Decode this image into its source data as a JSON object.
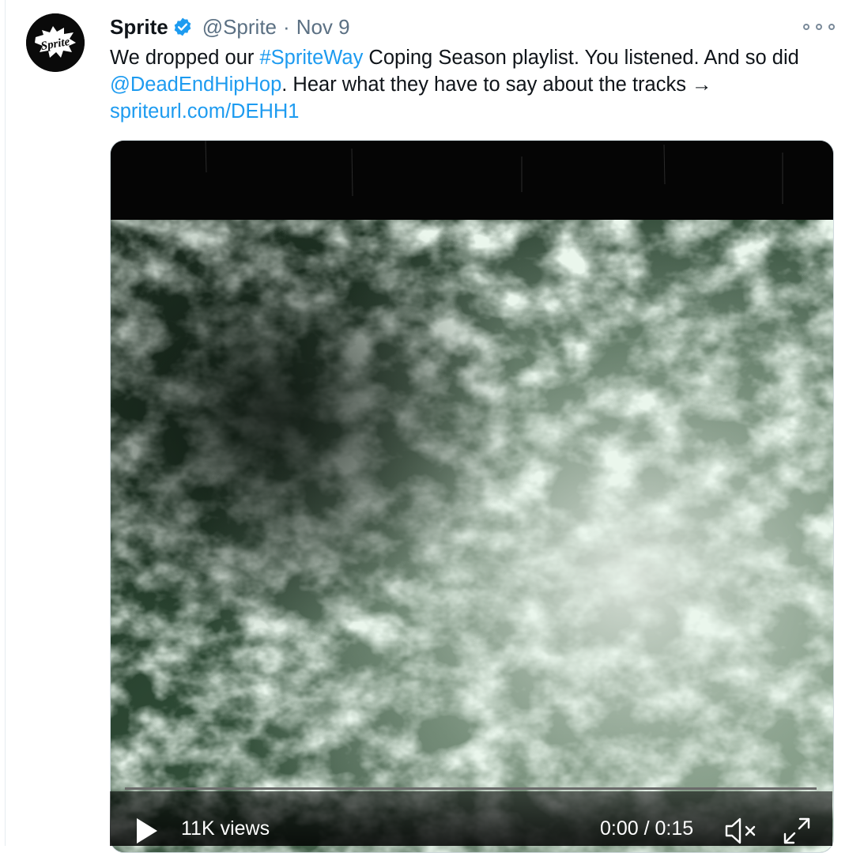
{
  "tweet": {
    "author_name": "Sprite",
    "handle": "@Sprite",
    "separator": "·",
    "date": "Nov 9",
    "avatar_logo_text": "Sprite",
    "text": {
      "t1": "We dropped our ",
      "hashtag": "#SpriteWay",
      "t2": " Coping Season playlist. You listened. And so did ",
      "mention": "@DeadEndHipHop",
      "t3": ". Hear what they have to say about the tracks → ",
      "link": "spriteurl.com/DEHH1"
    }
  },
  "video": {
    "views": "11K views",
    "time": "0:00 / 0:15",
    "progress": 0.0
  },
  "icons": {
    "verified": "verified-badge-icon",
    "more": "more-icon",
    "play": "play-icon",
    "mute": "volume-muted-icon",
    "fullscreen": "fullscreen-icon"
  },
  "colors": {
    "link": "#1d9bf0",
    "verified": "#1d9bf0",
    "muted_text": "#5b7083"
  }
}
